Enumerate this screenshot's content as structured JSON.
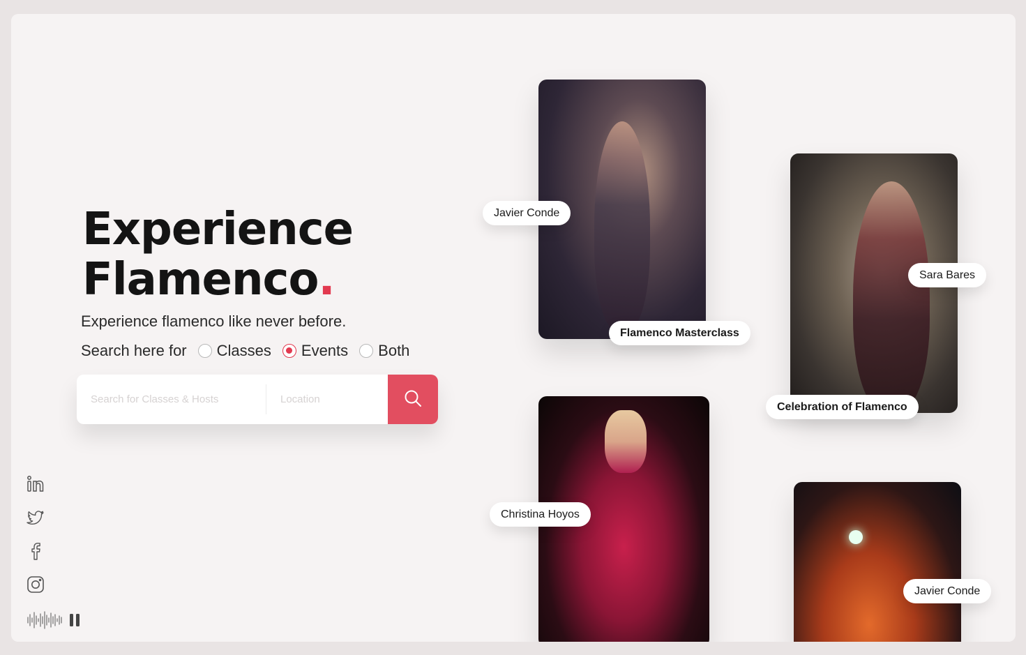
{
  "hero": {
    "title_line1": "Experience",
    "title_line2": "Flamenco",
    "title_dot": ".",
    "subtitle": "Experience flamenco like never before."
  },
  "search": {
    "label": "Search here for",
    "options": [
      {
        "label": "Classes",
        "checked": false
      },
      {
        "label": "Events",
        "checked": true
      },
      {
        "label": "Both",
        "checked": false
      }
    ],
    "query_placeholder": "Search for Classes & Hosts",
    "location_placeholder": "Location",
    "button_icon": "search-icon"
  },
  "socials": [
    "linkedin-icon",
    "twitter-icon",
    "facebook-icon",
    "instagram-icon"
  ],
  "audio": {
    "icon": "sound-wave-icon",
    "control": "pause-icon"
  },
  "cards": [
    {
      "title": "Flamenco Masterclass",
      "host": "Javier Conde"
    },
    {
      "title": "Celebration of Flamenco",
      "host": "Sara Bares"
    },
    {
      "title": "",
      "host": "Christina Hoyos"
    },
    {
      "title": "",
      "host": "Javier Conde"
    }
  ],
  "colors": {
    "accent": "#e2394f",
    "button": "#e24e60",
    "background": "#f6f3f3"
  }
}
